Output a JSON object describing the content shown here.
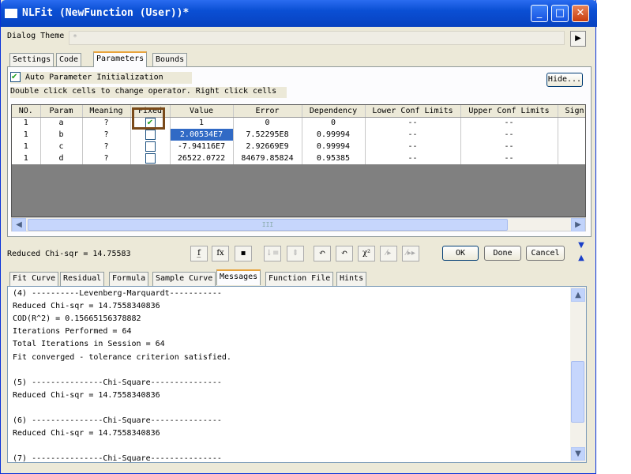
{
  "window": {
    "title": "NLFit (NewFunction (User))*",
    "minimize": "_",
    "maximize": "□",
    "close": "✕"
  },
  "theme": {
    "label": "Dialog Theme",
    "value": "*"
  },
  "top_tabs": [
    "Settings",
    "Code",
    "Parameters",
    "Bounds"
  ],
  "params": {
    "auto_init_label": "Auto Parameter Initialization",
    "auto_init_checked": true,
    "hide_label": "Hide...",
    "instruction": "Double click cells to change operator. Right click cells",
    "columns": [
      "NO.",
      "Param",
      "Meaning",
      "Fixed",
      "Value",
      "Error",
      "Dependency",
      "Lower Conf Limits",
      "Upper Conf Limits",
      "Sign:"
    ],
    "rows": [
      {
        "no": "1",
        "param": "a",
        "meaning": "?",
        "fixed": true,
        "value": "1",
        "error": "0",
        "dependency": "0",
        "lower": "--",
        "upper": "--"
      },
      {
        "no": "1",
        "param": "b",
        "meaning": "?",
        "fixed": false,
        "value": "2.00534E7",
        "error": "7.52295E8",
        "dependency": "0.99994",
        "lower": "--",
        "upper": "--"
      },
      {
        "no": "1",
        "param": "c",
        "meaning": "?",
        "fixed": false,
        "value": "-7.94116E7",
        "error": "2.92669E9",
        "dependency": "0.99994",
        "lower": "--",
        "upper": "--"
      },
      {
        "no": "1",
        "param": "d",
        "meaning": "?",
        "fixed": false,
        "value": "26522.0722",
        "error": "84679.85824",
        "dependency": "0.95385",
        "lower": "--",
        "upper": "--"
      }
    ],
    "scroll_grip": "III"
  },
  "status": {
    "chi_sqr": "Reduced Chi-sqr = 14.75583"
  },
  "toolbar": {
    "icons": [
      "f(x)",
      "fx",
      "save",
      "sort-down",
      "expand",
      "undo-1",
      "undo-all",
      "χ²",
      "iterate-1",
      "iterate-all"
    ],
    "labels": [
      "f̲",
      "fx",
      "▪",
      "↓≡",
      "⇕",
      "↶",
      "↶",
      "χ²",
      "⁄▸",
      "⁄▸▸"
    ]
  },
  "buttons": {
    "ok": "OK",
    "done": "Done",
    "cancel": "Cancel",
    "down": "▼",
    "up": "▲"
  },
  "bottom_tabs": [
    "Fit Curve",
    "Residual",
    "Formula",
    "Sample Curve",
    "Messages",
    "Function File",
    "Hints"
  ],
  "messages": [
    "(4) ----------Levenberg-Marquardt-----------",
    "Reduced Chi-sqr = 14.7558340836",
    "COD(R^2) = 0.15665156378882",
    "Iterations Performed = 64",
    "Total Iterations in Session = 64",
    "Fit converged - tolerance criterion satisfied.",
    "",
    "(5) ---------------Chi-Square---------------",
    "Reduced Chi-sqr = 14.7558340836",
    "",
    "(6) ---------------Chi-Square---------------",
    "Reduced Chi-sqr = 14.7558340836",
    "",
    "(7) ---------------Chi-Square---------------"
  ],
  "colors": {
    "title_bar": "#0a4fd4",
    "selection": "#316ac5",
    "highlight_box": "#7a4a1a"
  }
}
